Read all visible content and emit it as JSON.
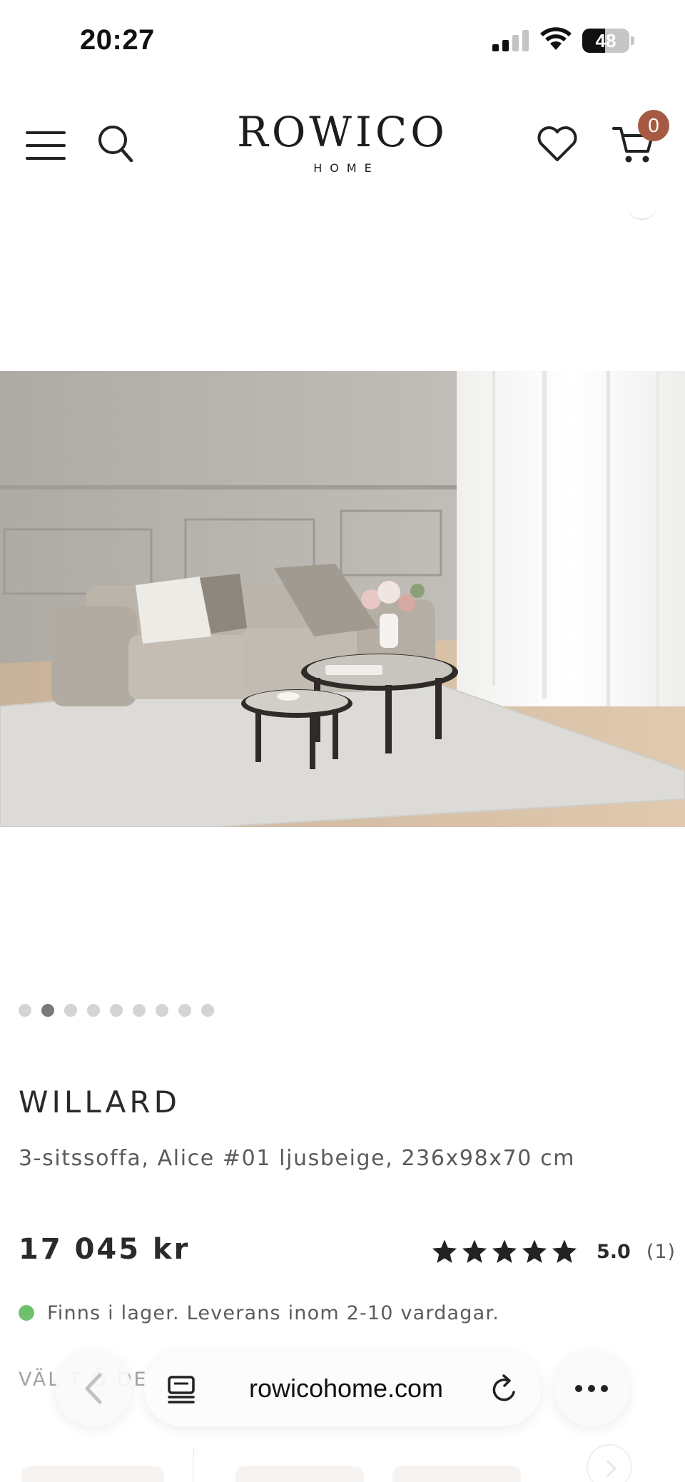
{
  "status_bar": {
    "time": "20:27",
    "battery_level": "48",
    "signal_bars_active": 2,
    "signal_bars_total": 4
  },
  "header": {
    "logo_main": "ROWICO",
    "logo_sub": "HOME",
    "cart_count": "0",
    "icons": [
      "menu-icon",
      "search-icon",
      "heart-icon",
      "cart-icon"
    ]
  },
  "gallery": {
    "total_images": 9,
    "active_index": 1
  },
  "product": {
    "name": "WILLARD",
    "description": "3-sitssoffa, Alice #01 ljusbeige, 236x98x70 cm",
    "price": "17 045 kr",
    "rating_value": "5.0",
    "rating_count": "(1)",
    "rating_stars": 5,
    "stock_text": "Finns i lager. Leverans inom 2-10 vardagar."
  },
  "variant": {
    "label": "VÄL  T  Ö    DE"
  },
  "browser": {
    "url": "rowicohome.com",
    "icons": [
      "back-icon",
      "tabs-icon",
      "reload-icon",
      "more-icon"
    ]
  },
  "colors": {
    "accent_badge": "#a65a43",
    "stock_dot": "#6dc06e",
    "text": "#2a2a2a"
  }
}
